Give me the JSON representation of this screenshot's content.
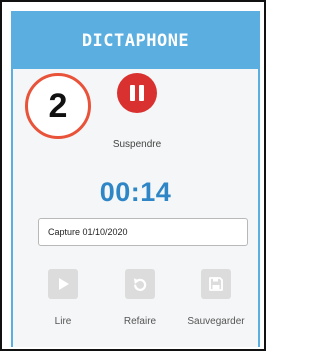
{
  "app": {
    "title": "DICTAPHONE",
    "step_number": "2"
  },
  "recorder": {
    "pause_label": "Suspendre",
    "timer": "00:14",
    "recording_name_value": "Capture 01/10/2020"
  },
  "actions": {
    "play_label": "Lire",
    "redo_label": "Refaire",
    "save_label": "Sauvegarder"
  },
  "icons": {
    "pause": "pause-icon",
    "play": "play-icon",
    "redo": "undo-arrow-icon",
    "save": "floppy-disk-icon"
  },
  "colors": {
    "header": "#5aaee0",
    "pause_button": "#d9312f",
    "timer_text": "#2f86c6",
    "step_circle_border": "#e8533a",
    "disabled_button": "#dcdcdc"
  }
}
